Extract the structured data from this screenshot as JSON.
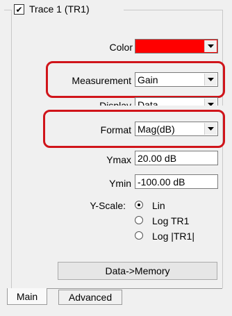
{
  "trace_group": {
    "title": "Trace 1 (TR1)",
    "checked": true,
    "color_label": "Color",
    "color_value": "#ff0000",
    "measurement_label": "Measurement",
    "measurement_value": "Gain",
    "display_label": "Display",
    "display_value": "Data",
    "format_label": "Format",
    "format_value": "Mag(dB)",
    "ymax_label": "Ymax",
    "ymax_value": "20.00 dB",
    "ymin_label": "Ymin",
    "ymin_value": "-100.00 dB",
    "yscale_label": "Y-Scale:",
    "yscale_options": [
      "Lin",
      "Log TR1",
      "Log |TR1|"
    ],
    "yscale_selected": "Lin",
    "data_memory_button": "Data->Memory"
  },
  "tabs": [
    {
      "label": "Main",
      "active": true
    },
    {
      "label": "Advanced",
      "active": false
    }
  ],
  "colors": {
    "highlight": "#d0141a",
    "trace_color": "#ff0000"
  }
}
